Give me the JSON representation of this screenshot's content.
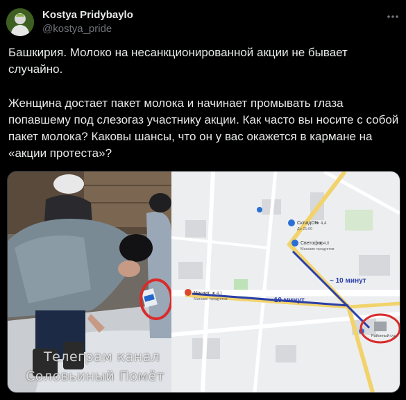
{
  "author": {
    "name": "Kostya Pridybaylo",
    "handle": "@kostya_pride"
  },
  "tweet": {
    "paragraph1": "Башкирия. Молоко на несанкционированной акции не бывает случайно.",
    "paragraph2": "Женщина достает пакет молока и начинает промывать глаза попавшему под слезогаз участнику акции. Как часто вы носите с собой пакет молока? Каковы шансы, что он у вас окажется в кармане на «акции протеста»?"
  },
  "media": {
    "watermark_line1": "Телеграм канал",
    "watermark_line2": "Соловьиный Помёт",
    "map": {
      "route1_label": "~ 10 минут",
      "route2_label": "~10 минут",
      "poi_skladok": "СкладОК",
      "poi_skladok_rating": "★ 4,4",
      "poi_skladok_sub": "До 21:00",
      "poi_svetofor": "Светофор",
      "poi_svetofor_rating": "★ 4,0",
      "poi_svetofor_sub": "Магазин продуктов",
      "poi_magnit": "Магнит",
      "poi_magnit_rating": "★ 4,1",
      "poi_magnit_sub": "Магазин продуктов",
      "poi_court": "Районный суд",
      "accent_route": "#2b3fa8",
      "accent_circle": "#d92b2b"
    }
  },
  "icons": {
    "more": "more-icon",
    "shop": "shop-icon"
  }
}
